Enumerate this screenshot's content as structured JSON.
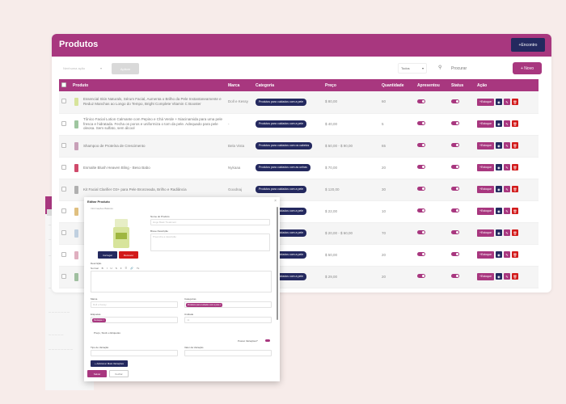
{
  "header": {
    "title": "Produtos",
    "encontro_label": "+Encontro"
  },
  "toolbar": {
    "bulk_placeholder": "Nenhuma ação",
    "aplicar_label": "Aplicar",
    "status_value": "Todos",
    "search_placeholder": "Procurar",
    "novo_label": "+ Novo"
  },
  "columns": [
    "Produto",
    "Marca",
    "Categoria",
    "Preço",
    "Quantidade",
    "Apresentou",
    "Status",
    "Ação"
  ],
  "rows": [
    {
      "name": "Essencial Skin Naturals, Sérum Facial, Aumenta o Brilho da Pele Instantaneamente e Reduz Manchas ao Longo do Tempo, Bright Complete Vitamin C Booster",
      "brand": "Doll e Kessy",
      "category": "Produtos para cuidados com a pele",
      "price": "$ 80,00",
      "qty": "60"
    },
    {
      "name": "Tônico Facial Lotion Calmante com Pepino e Chá Verde + Niacinamida para uma pele fresca e hidratada. Fecha os poros e uniformiza o tom da pele. Adequado para pele oleosa. Sem sulfato, sem álcool",
      "brand": "-",
      "category": "Produtos para cuidados com a pele",
      "price": "$ 40,00",
      "qty": "5"
    },
    {
      "name": "Shampoo de Proteína de Crescimento",
      "brand": "Bela Vista",
      "category": "Produtos para cuidados com os cabelos",
      "price": "$ 50,00 - $ 90,00",
      "qty": "65"
    },
    {
      "name": "Esmalte Blush Heaven Bling - Beso Babo",
      "brand": "Nykaaa",
      "category": "Produtos para cuidados com as unhas",
      "price": "$ 70,00",
      "qty": "20"
    },
    {
      "name": "Kit Facial Clarifier O3+ para Pele Bronzeada, Brilho e Radiância",
      "brand": "Goodnaj",
      "category": "Produtos para cuidados com a pele",
      "price": "$ 120,00",
      "qty": "30"
    },
    {
      "name": "",
      "brand": "",
      "category": "Produtos para cuidados com a pele",
      "price": "$ 22,00",
      "qty": "10"
    },
    {
      "name": "",
      "brand": "",
      "category": "Produtos para cuidados com a pele",
      "price": "$ 20,00 - $ 60,00",
      "qty": "70"
    },
    {
      "name": "",
      "brand": "",
      "category": "Produtos para cuidados com a pele",
      "price": "$ 50,00",
      "qty": "20"
    },
    {
      "name": "",
      "brand": "",
      "category": "Produtos para cuidados com a pele",
      "price": "$ 29,00",
      "qty": "20"
    },
    {
      "name": "",
      "brand": "",
      "category": "Produtos para cuidados com a pele",
      "price": "$ 40,00 - $ 75,00",
      "qty": "30"
    }
  ],
  "row_actions": {
    "estoque_label": "+Estoque"
  },
  "modal": {
    "title": "Editar Produto",
    "section_basic": "Informações Básicas",
    "name_label": "Nome do Produto",
    "name_value": "Hugo Bask Treatment",
    "desc_label": "Breve Descrição",
    "desc_placeholder": "Preencha a descrição",
    "alterar_label": "Carregar",
    "remover_label": "Remover",
    "descricao_label": "Descrição",
    "editor_tools": [
      "Normal",
      "B",
      "I",
      "U",
      "S",
      "≡",
      "☰",
      "🔗",
      "Tx"
    ],
    "marca_label": "Marca",
    "marca_value": "Doll e Kessy",
    "categorias_label": "Categorias",
    "categoria_tag": "Produtos para cuidados com a pele ×",
    "etiquetas_label": "Etiquetas",
    "etiqueta_tag": "Destaque ×",
    "unidade_label": "Unidade",
    "unidade_value": "ml",
    "preco_section": "Preço, Stock e Etiquetas",
    "variacoes_label": "Possui Variações?",
    "tipo_variacao_label": "Tipo de Variação",
    "valor_variacao_label": "Valor da Variação",
    "add_variacoes_label": "+ Adicionar Mais Variações",
    "salvar_label": "Salvar",
    "fechar_label": "Fechar"
  },
  "colors": {
    "accent": "#a8377f",
    "navy": "#24295f",
    "danger": "#d21b1b"
  }
}
